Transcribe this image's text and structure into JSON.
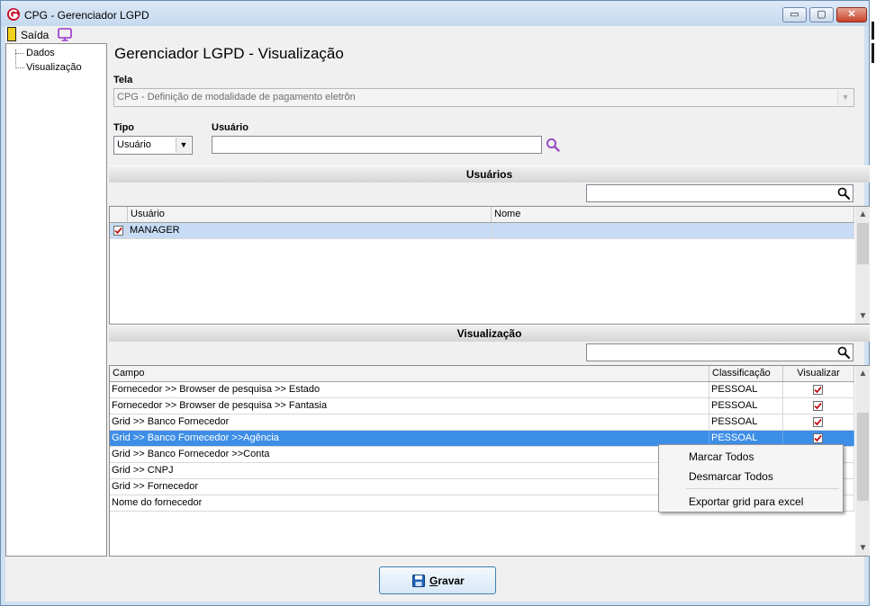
{
  "window": {
    "title": "CPG - Gerenciador LGPD",
    "controls": {
      "minimize": "▭",
      "maximize": "▢",
      "close": "✕"
    }
  },
  "menu": {
    "exit_label": "Saída"
  },
  "tree": {
    "items": [
      {
        "label": "Dados"
      },
      {
        "label": "Visualização"
      }
    ]
  },
  "page_title": "Gerenciador LGPD - Visualização",
  "tela": {
    "label": "Tela",
    "value": "CPG - Definição de modalidade de pagamento eletrôn"
  },
  "tipo": {
    "label": "Tipo",
    "value": "Usuário"
  },
  "usuario_field": {
    "label": "Usuário",
    "value": ""
  },
  "users_section": {
    "title": "Usuários",
    "search_value": "",
    "columns": [
      "Usuário",
      "Nome"
    ],
    "rows": [
      {
        "checked": true,
        "usuario": "MANAGER",
        "nome": ""
      }
    ]
  },
  "view_section": {
    "title": "Visualização",
    "search_value": "",
    "columns": [
      "Campo",
      "Classificação",
      "Visualizar"
    ],
    "rows": [
      {
        "campo": "Fornecedor >> Browser de pesquisa >> Estado",
        "classificacao": "PESSOAL",
        "visualizar": true
      },
      {
        "campo": "Fornecedor >> Browser de pesquisa >> Fantasia",
        "classificacao": "PESSOAL",
        "visualizar": true
      },
      {
        "campo": "Grid >> Banco Fornecedor",
        "classificacao": "PESSOAL",
        "visualizar": true
      },
      {
        "campo": "Grid >> Banco Fornecedor >>Agência",
        "classificacao": "PESSOAL",
        "visualizar": true,
        "selected": true
      },
      {
        "campo": "Grid >> Banco Fornecedor >>Conta",
        "classificacao": "",
        "visualizar": null
      },
      {
        "campo": "Grid >> CNPJ",
        "classificacao": "",
        "visualizar": null
      },
      {
        "campo": "Grid >> Fornecedor",
        "classificacao": "",
        "visualizar": null
      },
      {
        "campo": "Nome do fornecedor",
        "classificacao": "",
        "visualizar": null
      }
    ]
  },
  "context_menu": {
    "items": [
      "Marcar Todos",
      "Desmarcar Todos",
      "Exportar grid para excel"
    ]
  },
  "save_button": {
    "label_first": "G",
    "label_rest": "ravar"
  },
  "colors": {
    "selection": "#3d8ee6",
    "light_selection": "#c7dbf4",
    "check": "#c0141c",
    "logo": "#c8102e",
    "search_icon": "#9b4fc4"
  }
}
